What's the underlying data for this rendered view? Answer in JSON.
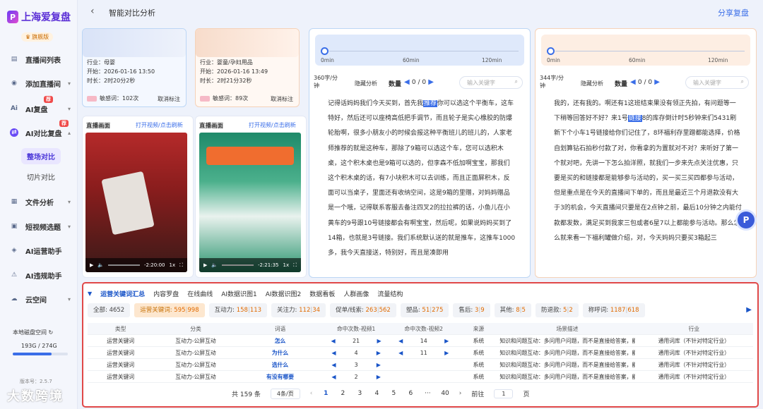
{
  "app": {
    "logo_mark": "P",
    "name": "上海爱复盘",
    "badge": "旗舰版"
  },
  "sidebar": {
    "items": [
      {
        "label": "直播间列表",
        "icon": "chart-icon"
      },
      {
        "label": "添加直播间",
        "icon": "user-add-icon"
      },
      {
        "label": "AI复盘",
        "icon": "ai-icon",
        "badge": "荐"
      },
      {
        "label": "AI对比复盘",
        "icon": "compare-icon",
        "badge": "荐",
        "active": true
      },
      {
        "label": "文件分析",
        "icon": "file-icon"
      },
      {
        "label": "短视频选题",
        "icon": "video-icon"
      },
      {
        "label": "AI运营助手",
        "icon": "robot-icon"
      },
      {
        "label": "AI违规助手",
        "icon": "warn-icon"
      },
      {
        "label": "云空间",
        "icon": "cloud-icon"
      }
    ],
    "subitems": [
      {
        "label": "整场对比",
        "selected": true
      },
      {
        "label": "切片对比"
      }
    ],
    "disk_label": "本地磁盘空间",
    "disk_used": "193G / 274G",
    "disk_fraction": 0.704,
    "version": "版本号：2.5.7",
    "watermark": "大数跨境"
  },
  "header": {
    "back_icon": "back-arrow-icon",
    "title": "智能对比分析",
    "share": "分享复盘"
  },
  "rooms": [
    {
      "industry": "行业：母婴",
      "start": "开始：2026-01-16 13:50",
      "duration": "时长：2时20分2秒",
      "sens": "敏感词：102次",
      "cancel": "取消标注",
      "live_label": "直播画面",
      "open": "打开视频/点击刷新",
      "time": "-2:20:00",
      "speed": "1x"
    },
    {
      "industry": "行业：婴童/孕妇用品",
      "start": "开始：2026-01-16 13:49",
      "duration": "时长：2时21分32秒",
      "sens": "敏感词：89次",
      "cancel": "取消标注",
      "live_label": "直播画面",
      "open": "打开视频/点击刷新",
      "time": "-2:21:35",
      "speed": "1x"
    }
  ],
  "transcripts": [
    {
      "rate": "360字/分钟",
      "hide": "隐藏分析",
      "qty_label": "数量",
      "count": "0 / 0",
      "kw_placeholder": "输入关键字",
      "tl": [
        "0min",
        "60min",
        "120min"
      ],
      "before": "记得话妈妈我们今天买到，首先我",
      "hl": "推荐",
      "after": "你可以选这个平衡车，这车特好，然后还可以座椅高低把手调节，而且轮子是实心橡胶的防爆轮胎啊，很多小朋友小的时候会报这种平衡班儿的班儿的，人家老师推荐的就是这种车，那除了9箱可以选这个车，您可以选积木桌，这个积木桌也是9箱可以选的，但李森不低加啊宝宝，那我们这个积木桌的话，有7小块积木可以去训练，而且正面屏积木，反面可以当桌子，里面还有收纳空间，这是9箱的里赠，对妈妈赠品是一个哦，记得联系客服去备注四叉2的拉拉裤的话，小鱼儿在小黄车的9号跟10号链接都会有啊宝宝，然后呢，如果说妈妈买到了14箱，也就是3号链接。我们系统默认送的就是推车，这推车1000多，我今天直接送，特别好，而且是凑即用"
    },
    {
      "rate": "344字/分钟",
      "hide": "隐藏分析",
      "qty_label": "数量",
      "count": "0 / 0",
      "kw_placeholder": "输入关键字",
      "tl": [
        "0min",
        "60min",
        "120min"
      ],
      "before": "我的，还有我的。啊还有1这班结束果没有领正先拍，有问题等一下稍等回答好不好？来1号",
      "hl": "链接",
      "after": "8的库存倒计时5秒钟来们5431刷新下个小车1号链接给你们记住了，8环福利存里蹭都能选择，价格自划算钻石拍秒付款了对，你看拿的为置就对不对？来听好了第一个就对吧，先讲一下怎么拍洋照，就我们一步来先点关注优惠，只要是买的和链接都是能够参与活动的，买一买三买四都参与活动，但是重点是在今天的直播间下单的，而且是最近三个月退款没有大于3的机会，今天直播间只要是在2点钟之前，最后10分钟之内能付款都发数，满足买到我家三包或者6星7以上都能参与活动。那么怎么就来看一下福利罐做介绍，对，今天妈妈只要买3箱起三"
    }
  ],
  "bottom": {
    "tabs": [
      "运营关键词汇总",
      "内容罗盘",
      "在线曲线",
      "AI数据识图1",
      "AI数据识图2",
      "数据看板",
      "人群画像",
      "流量结构"
    ],
    "chips": [
      {
        "label": "全部: 4652",
        "a": "",
        "b": ""
      },
      {
        "label": "运营关键词: ",
        "a": "595",
        "b": "998",
        "active": true
      },
      {
        "label": "互动力: ",
        "a": "158",
        "b": "113"
      },
      {
        "label": "关注力: ",
        "a": "112",
        "b": "34"
      },
      {
        "label": "促单/线索: ",
        "a": "263",
        "b": "562"
      },
      {
        "label": "塑品: ",
        "a": "51",
        "b": "275"
      },
      {
        "label": "售后: ",
        "a": "3",
        "b": "9"
      },
      {
        "label": "其他: ",
        "a": "8",
        "b": "5"
      },
      {
        "label": "防退款: ",
        "a": "5",
        "b": "2"
      },
      {
        "label": "称呼词: ",
        "a": "1187",
        "b": "618"
      }
    ],
    "columns": [
      "类型",
      "分类",
      "词语",
      "命中次数-视频1",
      "命中次数-视频2",
      "来源",
      "场景描述",
      "行业"
    ],
    "rows": [
      [
        "运营关键词",
        "互动力-公屏互动",
        "怎么",
        "21",
        "14",
        "系统",
        "知识和问题互动：多问用户问题，而不是直接给答案，能提升互动率和在线...",
        "通用词库（不针对特定行业）"
      ],
      [
        "运营关键词",
        "互动力-公屏互动",
        "为什么",
        "4",
        "11",
        "系统",
        "知识和问题互动：多问用户问题，而不是直接给答案，能提升互动率和在线...",
        "通用词库（不针对特定行业）"
      ],
      [
        "运营关键词",
        "互动力-公屏互动",
        "选什么",
        "3",
        "",
        "系统",
        "知识和问题互动：多问用户问题，而不是直接给答案，能提升互动率和在线...",
        "通用词库（不针对特定行业）"
      ],
      [
        "运营关键词",
        "互动力-公屏互动",
        "有没有哪要",
        "2",
        "",
        "系统",
        "知识和问题互动：多问用户问题，而不是直接给答案，能提升互动率和在线...",
        "通用词库（不针对特定行业）"
      ]
    ],
    "pager": {
      "total": "共 159 条",
      "size": "4条/页",
      "pages": [
        "1",
        "2",
        "3",
        "4",
        "5",
        "6",
        "···",
        "40"
      ],
      "goto": "前往",
      "page": "1",
      "unit": "页"
    }
  }
}
